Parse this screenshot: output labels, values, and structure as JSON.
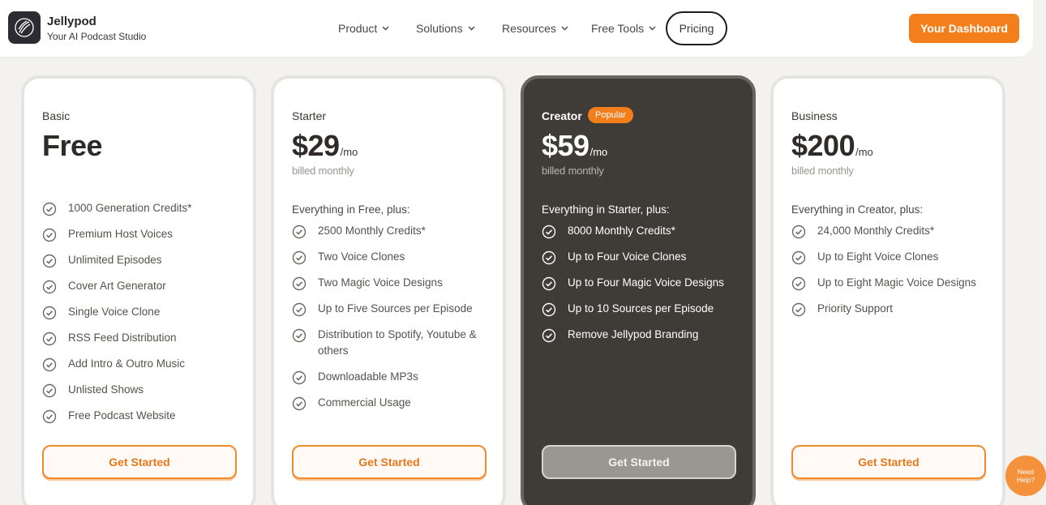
{
  "brand": {
    "name": "Jellypod",
    "tagline": "Your AI Podcast Studio"
  },
  "nav": {
    "items": [
      {
        "label": "Product"
      },
      {
        "label": "Solutions"
      },
      {
        "label": "Resources"
      },
      {
        "label": "Free Tools"
      }
    ],
    "pricing_label": "Pricing",
    "dashboard_label": "Your Dashboard"
  },
  "plans": [
    {
      "name": "Basic",
      "price": "Free",
      "per": "",
      "billed": "",
      "intro": "",
      "features": [
        "1000 Generation Credits*",
        "Premium Host Voices",
        "Unlimited Episodes",
        "Cover Art Generator",
        "Single Voice Clone",
        "RSS Feed Distribution",
        "Add Intro & Outro Music",
        "Unlisted Shows",
        "Free Podcast Website"
      ],
      "cta": "Get Started"
    },
    {
      "name": "Starter",
      "price": "$29",
      "per": "/mo",
      "billed": "billed monthly",
      "intro": "Everything in Free, plus:",
      "features": [
        "2500 Monthly Credits*",
        "Two Voice Clones",
        "Two Magic Voice Designs",
        "Up to Five Sources per Episode",
        "Distribution to Spotify, Youtube & others",
        "Downloadable MP3s",
        "Commercial Usage"
      ],
      "cta": "Get Started"
    },
    {
      "name": "Creator",
      "badge": "Popular",
      "price": "$59",
      "per": "/mo",
      "billed": "billed monthly",
      "intro": "Everything in Starter, plus:",
      "features": [
        "8000 Monthly Credits*",
        "Up to Four Voice Clones",
        "Up to Four Magic Voice Designs",
        "Up to 10 Sources per Episode",
        "Remove Jellypod Branding"
      ],
      "cta": "Get Started"
    },
    {
      "name": "Business",
      "price": "$200",
      "per": "/mo",
      "billed": "billed monthly",
      "intro": "Everything in Creator, plus:",
      "features": [
        "24,000 Monthly Credits*",
        "Up to Eight Voice Clones",
        "Up to Eight Magic Voice Designs",
        "Priority Support"
      ],
      "cta": "Get Started"
    }
  ],
  "help": {
    "line1": "Need",
    "line2": "Help?"
  },
  "colors": {
    "accent": "#f27f1c",
    "dark_card": "#3f3b36",
    "background": "#f3f2ef"
  },
  "icons": {
    "logo": "jellypod-logo-icon",
    "feature": "check-circle-icon",
    "nav": "chevron-down-icon"
  }
}
